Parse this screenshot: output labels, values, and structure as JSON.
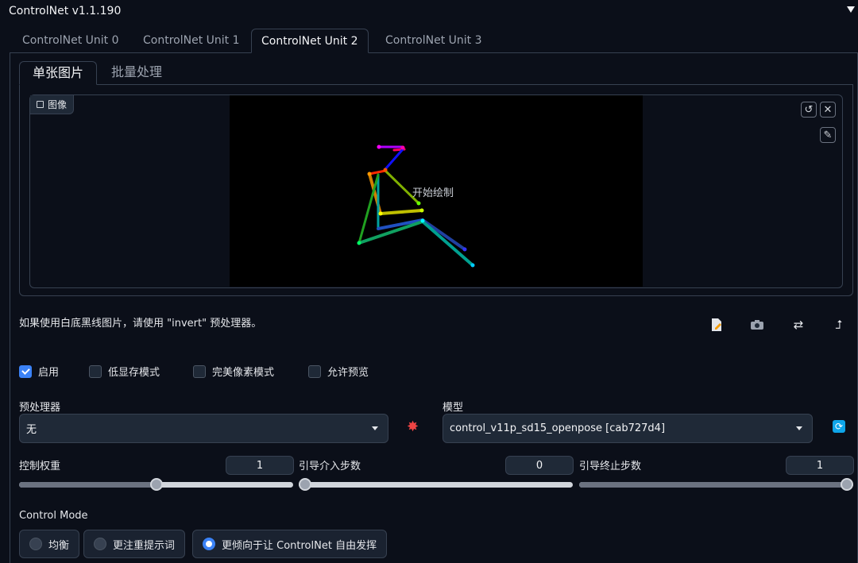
{
  "header": {
    "title": "ControlNet v1.1.190"
  },
  "unit_tabs": [
    "ControlNet Unit 0",
    "ControlNet Unit 1",
    "ControlNet Unit 2",
    "ControlNet Unit 3"
  ],
  "active_unit_tab": "ControlNet Unit 2",
  "mode_tabs": [
    "单张图片",
    "批量处理"
  ],
  "active_mode_tab": "单张图片",
  "image_panel": {
    "label": "图像",
    "canvas_hint": "开始绘制",
    "icons": [
      "undo-icon",
      "close-icon",
      "brush-icon"
    ]
  },
  "hint": "如果使用白底黑线图片，请使用 \"invert\" 预处理器。",
  "action_icons": [
    "edit-icon",
    "camera-icon",
    "swap-icon",
    "send-icon"
  ],
  "options": {
    "enable": {
      "label": "启用",
      "checked": true
    },
    "low_vram": {
      "label": "低显存模式",
      "checked": false
    },
    "pixel_perfect": {
      "label": "完美像素模式",
      "checked": false
    },
    "allow_preview": {
      "label": "允许预览",
      "checked": false
    }
  },
  "preprocessor": {
    "label": "预处理器",
    "value": "无"
  },
  "model": {
    "label": "模型",
    "value": "control_v11p_sd15_openpose [cab727d4]"
  },
  "sliders": {
    "weight": {
      "label": "控制权重",
      "value": "1",
      "fraction": 0.5
    },
    "start": {
      "label": "引导介入步数",
      "value": "0",
      "fraction": 0.0
    },
    "end": {
      "label": "引导终止步数",
      "value": "1",
      "fraction": 1.0
    }
  },
  "control_mode": {
    "label": "Control Mode",
    "options": [
      "均衡",
      "更注重提示词",
      "更倾向于让 ControlNet 自由发挥"
    ],
    "selected": "更倾向于让 ControlNet 自由发挥"
  },
  "colors": {
    "accent": "#3b82f6",
    "background": "#0b0f19",
    "panel": "#1f2937",
    "border": "#374151"
  }
}
